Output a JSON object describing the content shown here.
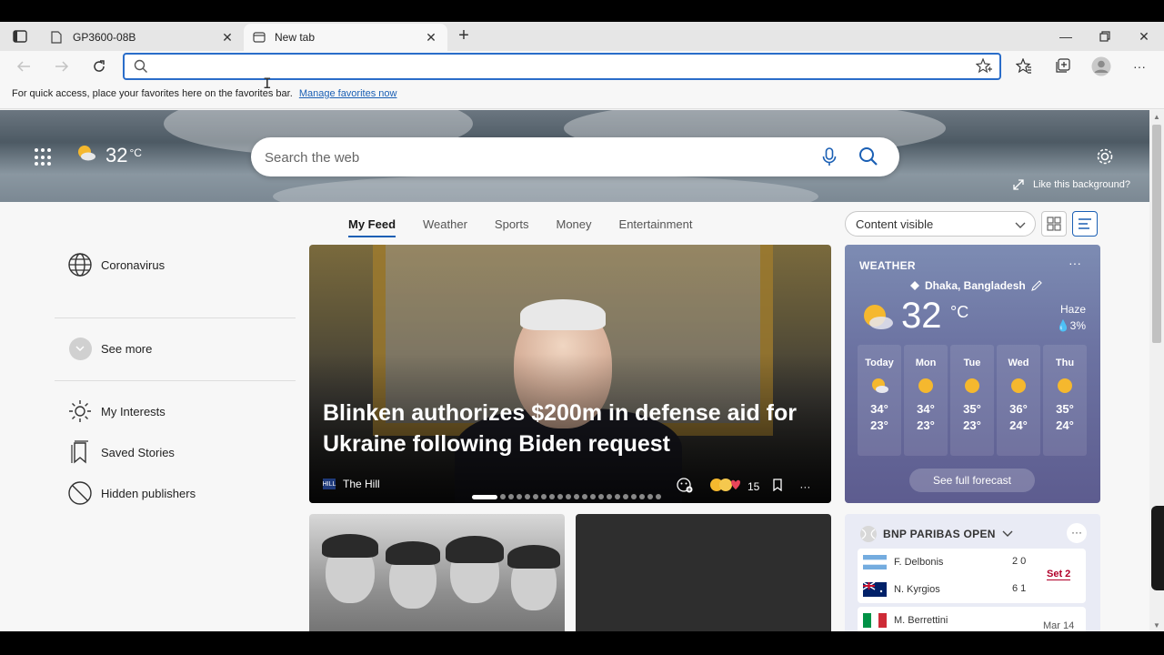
{
  "browser": {
    "tabs": [
      {
        "title": "GP3600-08B",
        "active": false
      },
      {
        "title": "New tab",
        "active": true
      }
    ],
    "address": {
      "value": "",
      "placeholder": ""
    },
    "favorites_bar": {
      "text": "For quick access, place your favorites here on the favorites bar.",
      "link": "Manage favorites now"
    }
  },
  "newtab": {
    "hero_weather": {
      "temp": "32",
      "unit": "°C"
    },
    "search_placeholder": "Search the web",
    "like_background": "Like this background?",
    "feed_tabs": [
      "My Feed",
      "Weather",
      "Sports",
      "Money",
      "Entertainment"
    ],
    "selected_tab": "My Feed",
    "content_select": "Content visible",
    "sidebar": {
      "coronavirus": "Coronavirus",
      "see_more": "See more",
      "my_interests": "My Interests",
      "saved_stories": "Saved Stories",
      "hidden_publishers": "Hidden publishers"
    },
    "hero_article": {
      "headline": "Blinken authorizes $200m in defense aid for Ukraine following Biden request",
      "source": "The Hill",
      "source_logo_text": "HILL",
      "reactions_count": "15",
      "more": "···"
    },
    "weather_card": {
      "title": "WEATHER",
      "more": "···",
      "location": "Dhaka, Bangladesh",
      "temp": "32",
      "unit": "°C",
      "condition": "Haze",
      "precip": "3%",
      "forecast": [
        {
          "day": "Today",
          "hi": "34°",
          "lo": "23°",
          "icon": "partly-sunny"
        },
        {
          "day": "Mon",
          "hi": "34°",
          "lo": "23°",
          "icon": "sunny"
        },
        {
          "day": "Tue",
          "hi": "35°",
          "lo": "23°",
          "icon": "sunny"
        },
        {
          "day": "Wed",
          "hi": "36°",
          "lo": "24°",
          "icon": "sunny"
        },
        {
          "day": "Thu",
          "hi": "35°",
          "lo": "24°",
          "icon": "sunny"
        }
      ],
      "full_forecast": "See full forecast"
    },
    "sports_card": {
      "title": "BNP PARIBAS OPEN",
      "more": "···",
      "match1": {
        "p1": "F. Delbonis",
        "p1_score": "2 0",
        "p2": "N. Kyrgios",
        "p2_score": "6 1",
        "status": "Set 2"
      },
      "match2": {
        "p1": "M. Berrettini",
        "date": "Mar 14"
      }
    }
  }
}
